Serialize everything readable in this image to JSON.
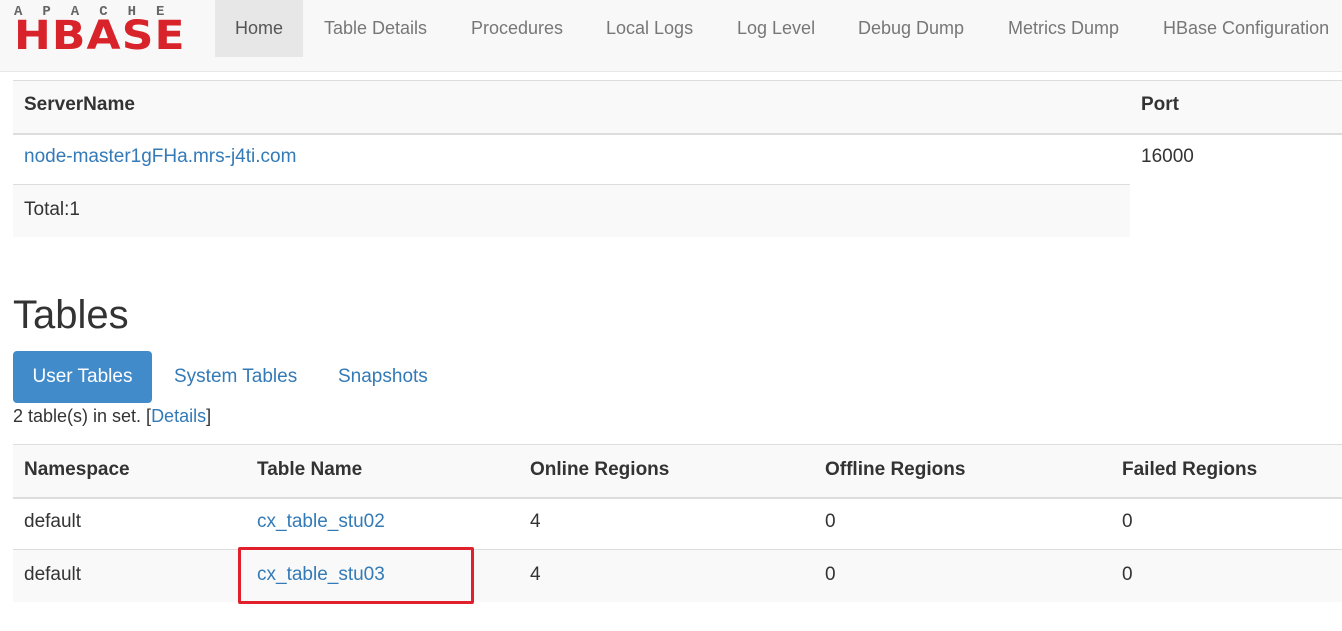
{
  "brand": {
    "top_text": "APACHE",
    "main_text": "HBASE"
  },
  "nav": {
    "items": [
      {
        "label": "Home",
        "active": true
      },
      {
        "label": "Table Details"
      },
      {
        "label": "Procedures"
      },
      {
        "label": "Local Logs"
      },
      {
        "label": "Log Level"
      },
      {
        "label": "Debug Dump"
      },
      {
        "label": "Metrics Dump"
      },
      {
        "label": "HBase Configuration"
      }
    ]
  },
  "servers": {
    "headers": [
      "ServerName",
      "Port"
    ],
    "rows": [
      {
        "name": "node-master1gFHa.mrs-j4ti.com",
        "port": "16000"
      }
    ],
    "total": "Total:1"
  },
  "tables_section": {
    "title": "Tables",
    "tabs": [
      "User Tables",
      "System Tables",
      "Snapshots"
    ],
    "count_prefix": "2 table(s) in set. [",
    "details_link": "Details",
    "count_suffix": "]",
    "headers": [
      "Namespace",
      "Table Name",
      "Online Regions",
      "Offline Regions",
      "Failed Regions"
    ],
    "rows": [
      {
        "namespace": "default",
        "table": "cx_table_stu02",
        "online": "4",
        "offline": "0",
        "failed": "0"
      },
      {
        "namespace": "default",
        "table": "cx_table_stu03",
        "online": "4",
        "offline": "0",
        "failed": "0"
      }
    ]
  },
  "colors": {
    "accent": "#428bca",
    "link": "#337ab7",
    "brand_red": "#d8232a",
    "highlight": "#e0202a"
  }
}
